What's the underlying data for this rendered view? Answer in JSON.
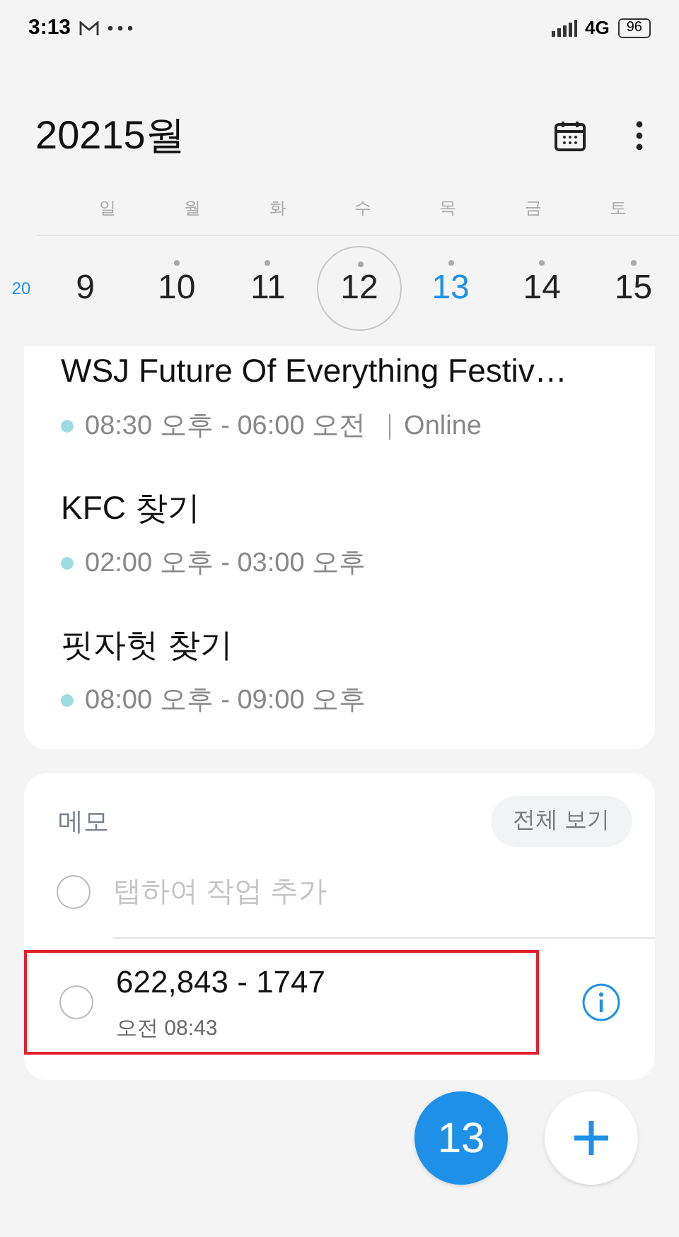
{
  "status_bar": {
    "time": "3:13",
    "network": "4G",
    "battery": "96"
  },
  "header": {
    "title": "20215월"
  },
  "weekdays": [
    "일",
    "월",
    "화",
    "수",
    "목",
    "금",
    "토"
  ],
  "week_number": "20",
  "days": [
    {
      "label": "9",
      "has_event": false,
      "selected": false,
      "today": false
    },
    {
      "label": "10",
      "has_event": true,
      "selected": false,
      "today": false
    },
    {
      "label": "11",
      "has_event": true,
      "selected": false,
      "today": false
    },
    {
      "label": "12",
      "has_event": true,
      "selected": true,
      "today": false
    },
    {
      "label": "13",
      "has_event": true,
      "selected": false,
      "today": true
    },
    {
      "label": "14",
      "has_event": true,
      "selected": false,
      "today": false
    },
    {
      "label": "15",
      "has_event": true,
      "selected": false,
      "today": false
    }
  ],
  "events": [
    {
      "title": "WSJ Future Of Everything Festiv…",
      "time": "08:30 오후 - 06:00 오전",
      "location": "Online",
      "color": "#9ddbe3"
    },
    {
      "title": "KFC 찾기",
      "time": "02:00 오후 - 03:00 오후",
      "color": "#9ddbe3"
    },
    {
      "title": "핏자헛 찾기",
      "time": "08:00 오후 - 09:00 오후",
      "color": "#9ddbe3"
    }
  ],
  "memo": {
    "title": "메모",
    "view_all": "전체 보기",
    "placeholder": "탭하여 작업 추가",
    "items": [
      {
        "text": "622,843 - 1747",
        "time": "오전 08:43",
        "checked": false,
        "highlighted": true
      }
    ]
  },
  "fab": {
    "today": "13"
  }
}
